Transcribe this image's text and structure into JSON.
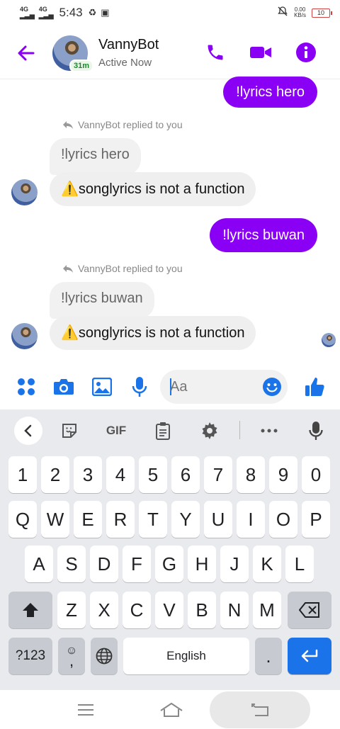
{
  "status_bar": {
    "network_1": "4G",
    "network_2": "4G",
    "time": "5:43",
    "speed_value": "0.00",
    "speed_unit": "KB/s",
    "battery": "10"
  },
  "header": {
    "back_icon": "arrow-left-icon",
    "contact_name": "VannyBot",
    "status": "Active Now",
    "avatar_badge": "31m",
    "accent_color": "#8a00f5"
  },
  "messages": [
    {
      "type": "outgoing",
      "text": "!lyrics hero"
    },
    {
      "type": "reply_note",
      "text": "VannyBot replied to you"
    },
    {
      "type": "quoted",
      "text": "!lyrics hero"
    },
    {
      "type": "incoming",
      "text": "⚠️songlyrics is not a function"
    },
    {
      "type": "outgoing",
      "text": "!lyrics buwan"
    },
    {
      "type": "reply_note",
      "text": "VannyBot replied to you"
    },
    {
      "type": "quoted",
      "text": "!lyrics buwan"
    },
    {
      "type": "incoming",
      "text": "⚠️songlyrics is not a function"
    }
  ],
  "composer": {
    "placeholder": "Aa"
  },
  "keyboard": {
    "toolbar": {
      "gif_label": "GIF"
    },
    "number_row": [
      "1",
      "2",
      "3",
      "4",
      "5",
      "6",
      "7",
      "8",
      "9",
      "0"
    ],
    "row1": [
      "Q",
      "W",
      "E",
      "R",
      "T",
      "Y",
      "U",
      "I",
      "O",
      "P"
    ],
    "row2": [
      "A",
      "S",
      "D",
      "F",
      "G",
      "H",
      "J",
      "K",
      "L"
    ],
    "row3": [
      "Z",
      "X",
      "C",
      "V",
      "B",
      "N",
      "M"
    ],
    "symbols_label": "?123",
    "comma_label": ",",
    "space_label": "English",
    "period_label": "."
  }
}
